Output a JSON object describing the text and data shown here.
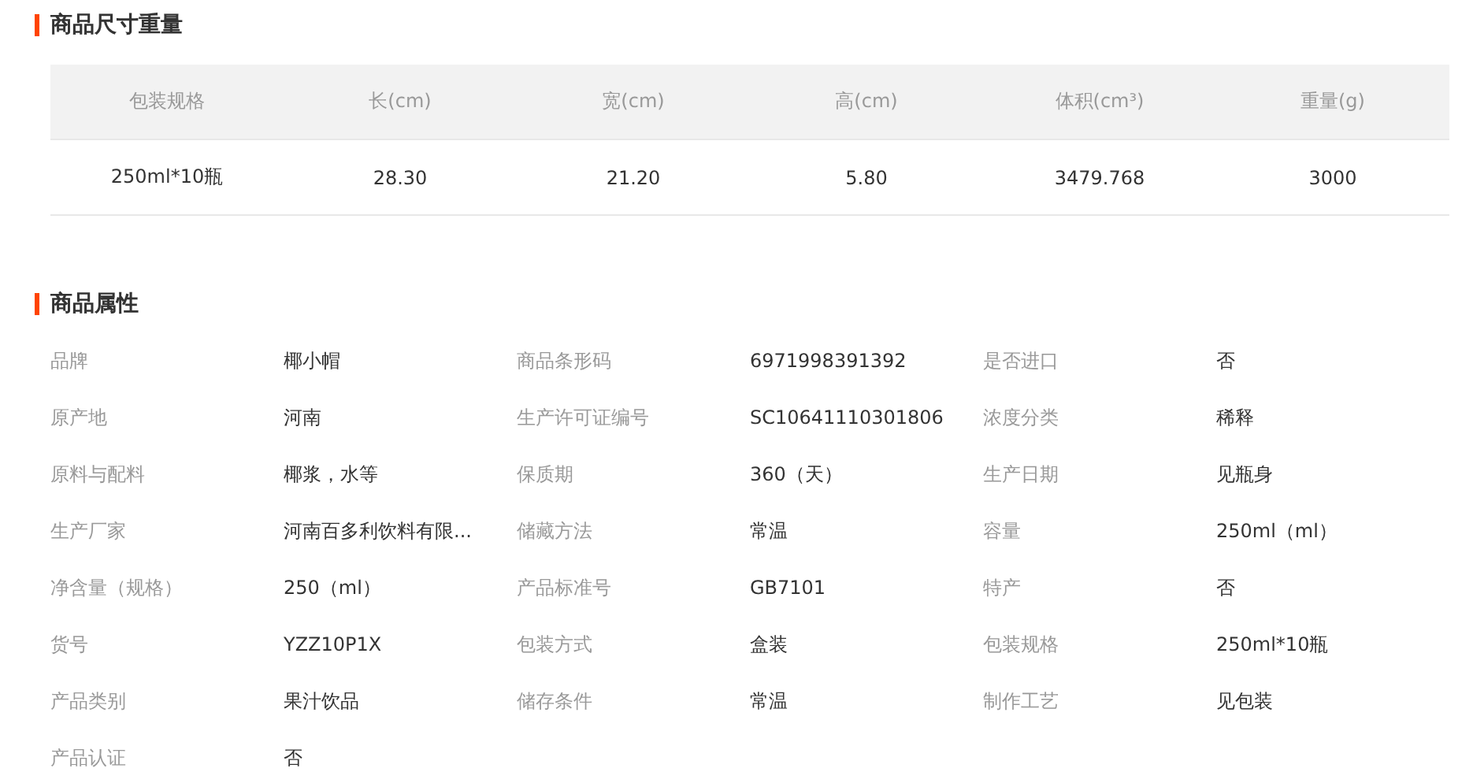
{
  "size_section": {
    "title": "商品尺寸重量",
    "columns": [
      "包装规格",
      "长(cm)",
      "宽(cm)",
      "高(cm)",
      "体积(cm³)",
      "重量(g)"
    ],
    "rows": [
      [
        "250ml*10瓶",
        "28.30",
        "21.20",
        "5.80",
        "3479.768",
        "3000"
      ]
    ]
  },
  "attributes_section": {
    "title": "商品属性",
    "items": [
      {
        "label": "品牌",
        "value": "椰小帽"
      },
      {
        "label": "商品条形码",
        "value": "6971998391392"
      },
      {
        "label": "是否进口",
        "value": "否"
      },
      {
        "label": "原产地",
        "value": "河南"
      },
      {
        "label": "生产许可证编号",
        "value": "SC10641110301806"
      },
      {
        "label": "浓度分类",
        "value": "稀释"
      },
      {
        "label": "原料与配料",
        "value": "椰浆，水等"
      },
      {
        "label": "保质期",
        "value": "360（天）"
      },
      {
        "label": "生产日期",
        "value": "见瓶身"
      },
      {
        "label": "生产厂家",
        "value": "河南百多利饮料有限..."
      },
      {
        "label": "储藏方法",
        "value": "常温"
      },
      {
        "label": "容量",
        "value": "250ml（ml）"
      },
      {
        "label": "净含量（规格）",
        "value": "250（ml）"
      },
      {
        "label": "产品标准号",
        "value": "GB7101"
      },
      {
        "label": "特产",
        "value": "否"
      },
      {
        "label": "货号",
        "value": "YZZ10P1X"
      },
      {
        "label": "包装方式",
        "value": "盒装"
      },
      {
        "label": "包装规格",
        "value": "250ml*10瓶"
      },
      {
        "label": "产品类别",
        "value": "果汁饮品"
      },
      {
        "label": "储存条件",
        "value": "常温"
      },
      {
        "label": "制作工艺",
        "value": "见包装"
      },
      {
        "label": "产品认证",
        "value": "否"
      }
    ]
  }
}
